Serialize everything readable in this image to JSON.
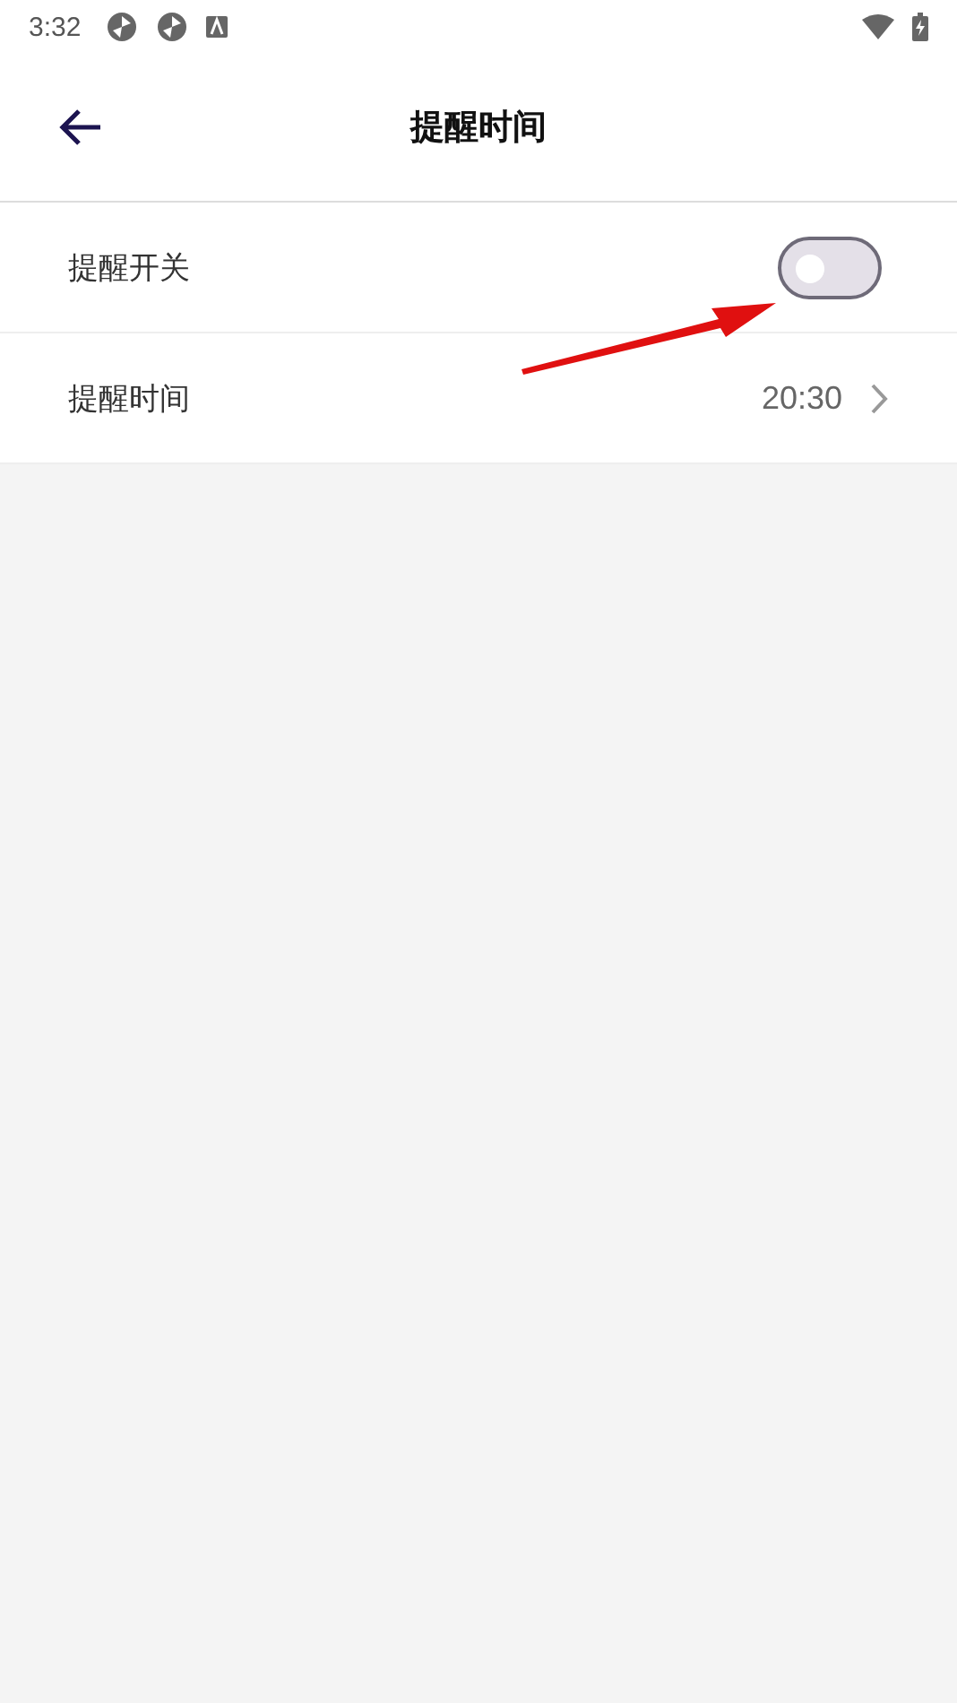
{
  "status_bar": {
    "time": "3:32"
  },
  "header": {
    "title": "提醒时间"
  },
  "settings": [
    {
      "kind": "toggle",
      "label": "提醒开关",
      "on": false
    },
    {
      "kind": "value",
      "label": "提醒时间",
      "value": "20:30"
    }
  ]
}
